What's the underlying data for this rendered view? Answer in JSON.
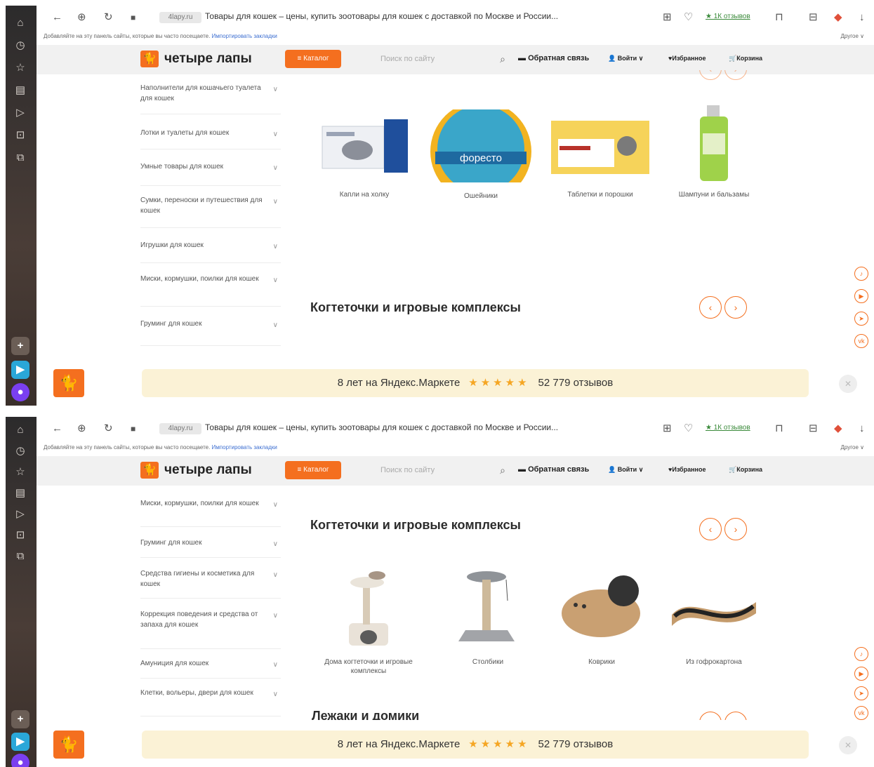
{
  "browser": {
    "page_title": "Товары для кошек – цены, купить зоотовары для кошек с доставкой по Москве и России...",
    "url_short": "4lapy.ru",
    "reviews_link": "★ 1К отзывов",
    "bookmarks_hint": "Добавляйте на эту панель сайты, которые вы часто посещаете.",
    "bookmarks_import": "Импортировать закладки",
    "bookmarks_other": "Другое ∨"
  },
  "site": {
    "brand": "четыре лапы",
    "catalog_label": "≡ Каталог",
    "search_placeholder": "Поиск по сайту",
    "feedback_label": "Обратная связь",
    "login_label": "Войти",
    "favorites_label": "Избранное",
    "cart_label": "Корзина"
  },
  "screen1": {
    "sidebar": [
      "Наполнители для кошачьего туалета для кошек",
      "Лотки и туалеты для кошек",
      "Умные товары для кошек",
      "Сумки, переноски и путешествия для кошек",
      "Игрушки для кошек",
      "Миски, кормушки, поилки для кошек",
      "Груминг для кошек"
    ],
    "categories": [
      "Капли на холку",
      "Ошейники",
      "Таблетки и порошки",
      "Шампуни и бальзамы"
    ],
    "section_title": "Когтеточки и игровые комплексы"
  },
  "screen2": {
    "sidebar": [
      "Миски, кормушки, поилки для кошек",
      "Груминг для кошек",
      "Средства гигиены и косметика для кошек",
      "Коррекция поведения и средства от запаха для кошек",
      "Амуниция для кошек",
      "Клетки, вольеры, двери для кошек"
    ],
    "section_title": "Когтеточки и игровые комплексы",
    "categories": [
      "Дома когтеточки и игровые комплексы",
      "Столбики",
      "Коврики",
      "Из гофрокартона"
    ],
    "next_section_title": "Лежаки и домики"
  },
  "banner": {
    "text": "8 лет на Яндекс.Маркете",
    "stars": "★★★★★",
    "reviews": "52 779 отзывов"
  },
  "colors": {
    "accent": "#f46f1f",
    "banner_bg": "#fbf2d6",
    "header_bg": "#f1f1f1"
  }
}
